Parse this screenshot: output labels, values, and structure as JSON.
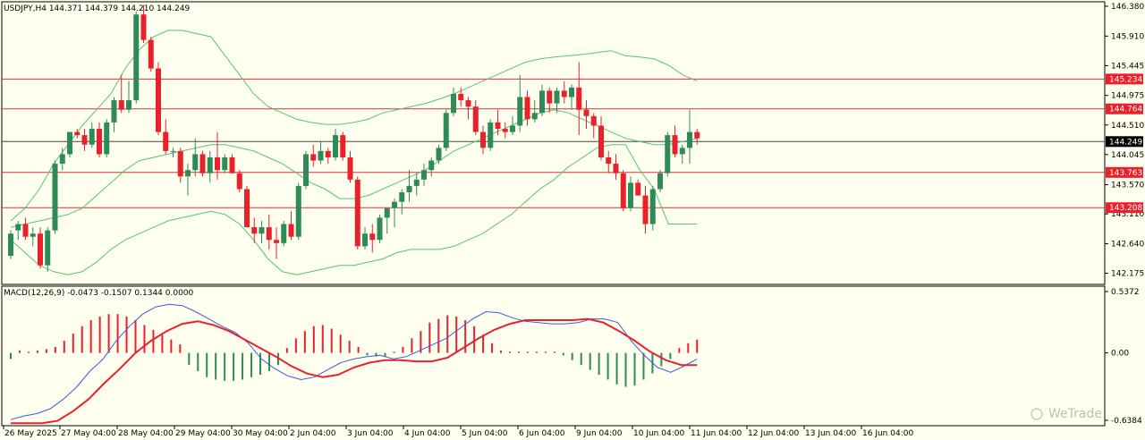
{
  "chart_data": [
    {
      "type": "candlestick",
      "title": "USDJPY,H4  144.371 144.379 144.210 144.249",
      "ylim": [
        142.0,
        146.45
      ],
      "y_ticks": [
        "146.380",
        "145.910",
        "145.445",
        "144.975",
        "144.510",
        "144.045",
        "143.570",
        "143.110",
        "142.640",
        "142.175"
      ],
      "current_price": "144.249",
      "levels": [
        "145.234",
        "144.764",
        "143.763",
        "143.208"
      ],
      "x_tick_labels": [
        "26 May 2025",
        "27 May 04:00",
        "28 May 04:00",
        "29 May 04:00",
        "30 May 04:00",
        "2 Jun 04:00",
        "3 Jun 04:00",
        "4 Jun 04:00",
        "5 Jun 04:00",
        "6 Jun 04:00",
        "9 Jun 04:00",
        "10 Jun 04:00",
        "11 Jun 04:00",
        "12 Jun 04:00",
        "13 Jun 04:00",
        "16 Jun 04:00"
      ],
      "candles": [
        [
          142.45,
          142.85,
          142.4,
          142.8
        ],
        [
          142.85,
          143.0,
          142.7,
          142.95
        ],
        [
          142.95,
          143.05,
          142.7,
          142.75
        ],
        [
          142.75,
          142.9,
          142.6,
          142.8
        ],
        [
          142.8,
          142.9,
          142.25,
          142.3
        ],
        [
          142.3,
          142.9,
          142.2,
          142.85
        ],
        [
          142.85,
          143.95,
          142.8,
          143.9
        ],
        [
          143.9,
          144.15,
          143.8,
          144.05
        ],
        [
          144.05,
          144.4,
          144.0,
          144.4
        ],
        [
          144.4,
          144.45,
          144.3,
          144.35
        ],
        [
          144.35,
          144.45,
          144.1,
          144.2
        ],
        [
          144.2,
          144.55,
          144.15,
          144.45
        ],
        [
          144.45,
          144.55,
          144.0,
          144.05
        ],
        [
          144.05,
          144.6,
          144.0,
          144.55
        ],
        [
          144.55,
          144.95,
          144.4,
          144.9
        ],
        [
          144.9,
          145.3,
          144.7,
          144.75
        ],
        [
          144.75,
          145.2,
          144.7,
          144.9
        ],
        [
          144.9,
          146.3,
          144.85,
          146.25
        ],
        [
          146.25,
          146.4,
          145.8,
          145.85
        ],
        [
          145.85,
          145.9,
          145.35,
          145.4
        ],
        [
          145.4,
          145.5,
          144.35,
          144.4
        ],
        [
          144.4,
          144.6,
          144.05,
          144.1
        ],
        [
          144.1,
          144.15,
          144.0,
          144.1
        ],
        [
          144.1,
          144.15,
          143.6,
          143.7
        ],
        [
          143.7,
          143.9,
          143.4,
          143.8
        ],
        [
          143.8,
          144.3,
          143.7,
          144.05
        ],
        [
          144.05,
          144.1,
          143.7,
          143.75
        ],
        [
          143.75,
          144.1,
          143.6,
          144.0
        ],
        [
          144.0,
          144.4,
          143.65,
          143.8
        ],
        [
          143.8,
          144.05,
          143.75,
          144.0
        ],
        [
          144.0,
          144.05,
          143.75,
          143.75
        ],
        [
          143.75,
          143.8,
          143.45,
          143.5
        ],
        [
          143.5,
          143.55,
          142.95,
          142.9
        ],
        [
          142.9,
          143.05,
          142.65,
          142.8
        ],
        [
          142.8,
          143.0,
          142.65,
          142.9
        ],
        [
          142.9,
          143.1,
          142.55,
          142.7
        ],
        [
          142.7,
          142.9,
          142.4,
          142.65
        ],
        [
          142.65,
          143.0,
          142.6,
          142.95
        ],
        [
          142.95,
          143.15,
          142.7,
          142.75
        ],
        [
          142.75,
          143.6,
          142.7,
          143.55
        ],
        [
          143.55,
          144.1,
          143.5,
          144.05
        ],
        [
          144.05,
          144.2,
          143.85,
          143.95
        ],
        [
          143.95,
          144.25,
          143.9,
          144.1
        ],
        [
          144.1,
          144.15,
          143.9,
          144.0
        ],
        [
          144.0,
          144.45,
          143.95,
          144.35
        ],
        [
          144.35,
          144.4,
          143.95,
          144.0
        ],
        [
          144.0,
          144.1,
          143.6,
          143.65
        ],
        [
          143.65,
          143.7,
          142.55,
          142.6
        ],
        [
          142.6,
          142.9,
          142.55,
          142.8
        ],
        [
          142.8,
          142.95,
          142.5,
          142.7
        ],
        [
          142.7,
          143.1,
          142.65,
          143.05
        ],
        [
          143.05,
          143.2,
          142.8,
          143.2
        ],
        [
          143.2,
          143.35,
          142.9,
          143.3
        ],
        [
          143.3,
          143.5,
          143.1,
          143.45
        ],
        [
          143.45,
          143.8,
          143.3,
          143.55
        ],
        [
          143.55,
          143.75,
          143.4,
          143.65
        ],
        [
          143.65,
          143.9,
          143.55,
          143.8
        ],
        [
          143.8,
          144.0,
          143.7,
          143.95
        ],
        [
          143.95,
          144.2,
          143.9,
          144.15
        ],
        [
          144.15,
          144.75,
          144.1,
          144.7
        ],
        [
          144.7,
          145.1,
          144.65,
          145.0
        ],
        [
          145.0,
          145.1,
          144.8,
          144.9
        ],
        [
          144.9,
          144.95,
          144.6,
          144.8
        ],
        [
          144.8,
          144.9,
          144.35,
          144.4
        ],
        [
          144.4,
          144.5,
          144.05,
          144.15
        ],
        [
          144.15,
          144.6,
          144.1,
          144.55
        ],
        [
          144.55,
          144.75,
          144.35,
          144.45
        ],
        [
          144.45,
          144.55,
          144.3,
          144.4
        ],
        [
          144.4,
          144.65,
          144.35,
          144.5
        ],
        [
          144.5,
          145.3,
          144.4,
          144.95
        ],
        [
          144.95,
          145.05,
          144.5,
          144.6
        ],
        [
          144.6,
          144.9,
          144.55,
          144.7
        ],
        [
          144.7,
          145.15,
          144.65,
          145.05
        ],
        [
          145.05,
          145.1,
          144.7,
          144.85
        ],
        [
          144.85,
          145.1,
          144.7,
          145.05
        ],
        [
          145.05,
          145.2,
          144.85,
          144.95
        ],
        [
          144.95,
          145.15,
          144.75,
          145.1
        ],
        [
          145.1,
          145.5,
          144.35,
          144.75
        ],
        [
          144.75,
          144.9,
          144.45,
          144.65
        ],
        [
          144.65,
          144.7,
          144.3,
          144.5
        ],
        [
          144.5,
          144.65,
          143.95,
          144.0
        ],
        [
          144.0,
          144.1,
          143.75,
          143.9
        ],
        [
          143.9,
          144.05,
          143.65,
          143.75
        ],
        [
          143.75,
          143.8,
          143.15,
          143.2
        ],
        [
          143.2,
          143.7,
          143.15,
          143.6
        ],
        [
          143.6,
          143.65,
          143.4,
          143.4
        ],
        [
          143.4,
          143.55,
          142.8,
          142.95
        ],
        [
          142.95,
          143.55,
          142.85,
          143.5
        ],
        [
          143.5,
          143.8,
          143.45,
          143.75
        ],
        [
          143.75,
          144.4,
          143.7,
          144.35
        ],
        [
          144.35,
          144.5,
          144.0,
          144.05
        ],
        [
          144.05,
          144.2,
          143.9,
          144.15
        ],
        [
          144.15,
          144.75,
          143.9,
          144.4
        ],
        [
          144.4,
          144.45,
          144.2,
          144.3
        ]
      ],
      "bb_upper": [
        143.0,
        143.2,
        143.5,
        143.9,
        144.2,
        144.5,
        144.75,
        145.0,
        145.4,
        145.7,
        145.9,
        146.0,
        146.0,
        145.95,
        145.9,
        145.6,
        145.3,
        145.0,
        144.8,
        144.7,
        144.6,
        144.55,
        144.52,
        144.52,
        144.55,
        144.6,
        144.7,
        144.75,
        144.8,
        144.85,
        144.92,
        145.0,
        145.1,
        145.2,
        145.3,
        145.4,
        145.5,
        145.55,
        145.58,
        145.6,
        145.62,
        145.65,
        145.68,
        145.6,
        145.58,
        145.55,
        145.45,
        145.3,
        145.2
      ],
      "bb_middle": [
        142.9,
        142.95,
        143.0,
        143.05,
        143.1,
        143.2,
        143.4,
        143.6,
        143.8,
        143.95,
        144.0,
        144.05,
        144.1,
        144.15,
        144.2,
        144.2,
        144.15,
        144.1,
        144.0,
        143.9,
        143.75,
        143.6,
        143.5,
        143.35,
        143.35,
        143.4,
        143.5,
        143.6,
        143.7,
        143.8,
        143.95,
        144.1,
        144.2,
        144.3,
        144.4,
        144.5,
        144.6,
        144.7,
        144.75,
        144.7,
        144.6,
        144.5,
        144.4,
        144.3,
        144.25,
        144.2,
        144.2,
        144.25,
        144.3
      ],
      "bb_lower": [
        142.7,
        142.5,
        142.3,
        142.2,
        142.15,
        142.2,
        142.35,
        142.55,
        142.7,
        142.8,
        142.9,
        143.0,
        143.05,
        143.1,
        143.15,
        143.1,
        142.95,
        142.7,
        142.4,
        142.2,
        142.15,
        142.2,
        142.25,
        142.3,
        142.3,
        142.35,
        142.4,
        142.5,
        142.55,
        142.55,
        142.55,
        142.6,
        142.7,
        142.8,
        142.95,
        143.1,
        143.3,
        143.5,
        143.65,
        143.85,
        144.0,
        144.15,
        144.2,
        144.2,
        143.8,
        143.5,
        142.95,
        142.95,
        142.95
      ]
    },
    {
      "type": "macd",
      "title": "MACD(12,26,9) -0.0473 -0.1507 0.1344 0.0000",
      "ylim": [
        -0.6,
        0.55
      ],
      "y_ticks": [
        "0.5372",
        "0.00",
        "-0.6384"
      ],
      "histogram": [
        -0.05,
        0.02,
        0.01,
        0.02,
        0.03,
        0.05,
        0.1,
        0.16,
        0.22,
        0.27,
        0.3,
        0.32,
        0.32,
        0.3,
        0.27,
        0.23,
        0.19,
        0.15,
        0.11,
        0.07,
        -0.1,
        -0.15,
        -0.2,
        -0.22,
        -0.23,
        -0.23,
        -0.22,
        -0.2,
        -0.18,
        -0.15,
        -0.1,
        0.04,
        0.12,
        0.18,
        0.22,
        0.23,
        0.2,
        0.15,
        0.1,
        0.05,
        -0.02,
        -0.03,
        -0.03,
        0.01,
        0.05,
        0.12,
        0.18,
        0.25,
        0.28,
        0.31,
        0.3,
        0.27,
        0.22,
        0.15,
        0.08,
        0.02,
        0.01,
        0.01,
        0.01,
        0.01,
        0.01,
        0.01,
        -0.02,
        -0.06,
        -0.1,
        -0.14,
        -0.18,
        -0.22,
        -0.26,
        -0.28,
        -0.27,
        -0.22,
        -0.17,
        -0.11,
        -0.05,
        0.04,
        0.08,
        0.11
      ],
      "macd_line": [
        -0.55,
        -0.52,
        -0.5,
        -0.46,
        -0.38,
        -0.28,
        -0.15,
        -0.05,
        0.1,
        0.22,
        0.32,
        0.38,
        0.4,
        0.39,
        0.34,
        0.28,
        0.22,
        0.17,
        0.08,
        -0.05,
        -0.13,
        -0.19,
        -0.22,
        -0.2,
        -0.14,
        -0.08,
        -0.05,
        -0.03,
        -0.02,
        -0.05,
        -0.03,
        0.02,
        0.07,
        0.12,
        0.2,
        0.28,
        0.34,
        0.33,
        0.29,
        0.26,
        0.25,
        0.24,
        0.24,
        0.25,
        0.28,
        0.28,
        0.25,
        0.1,
        -0.02,
        -0.12,
        -0.16,
        -0.11,
        -0.05
      ],
      "signal_line": [
        -0.58,
        -0.58,
        -0.58,
        -0.56,
        -0.48,
        -0.38,
        -0.25,
        -0.13,
        0.0,
        0.1,
        0.18,
        0.24,
        0.26,
        0.23,
        0.18,
        0.11,
        0.04,
        -0.03,
        -0.11,
        -0.17,
        -0.2,
        -0.18,
        -0.12,
        -0.08,
        -0.06,
        -0.06,
        -0.07,
        -0.07,
        -0.04,
        0.04,
        0.12,
        0.19,
        0.24,
        0.27,
        0.27,
        0.27,
        0.27,
        0.28,
        0.25,
        0.18,
        0.1,
        0.01,
        -0.06,
        -0.1,
        -0.1
      ]
    }
  ],
  "watermark": "WeTrade"
}
